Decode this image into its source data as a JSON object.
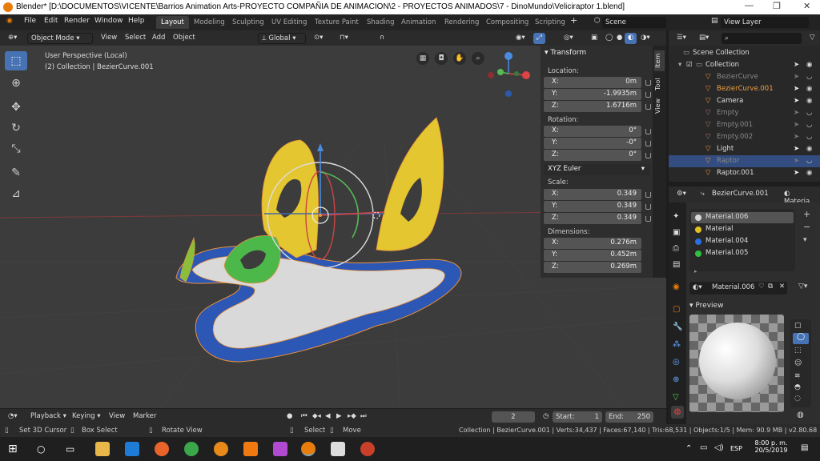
{
  "titlebar": {
    "title": "Blender* [D:\\DOCUMENTOS\\VICENTE\\Barrios Animation Arts-PROYECTO COMPAÑIA DE ANIMACION\\2 - PROYECTOS ANIMADOS\\7 - DinoMundo\\Veliciraptor 1.blend]"
  },
  "menu": [
    "File",
    "Edit",
    "Render",
    "Window",
    "Help"
  ],
  "workspaces": [
    "Layout",
    "Modeling",
    "Sculpting",
    "UV Editing",
    "Texture Paint",
    "Shading",
    "Animation",
    "Rendering",
    "Compositing",
    "Scripting"
  ],
  "scene": "Scene",
  "view_layer": "View Layer",
  "viewport_header": {
    "mode": "Object Mode",
    "menus": [
      "View",
      "Select",
      "Add",
      "Object"
    ],
    "orientation": "Global"
  },
  "viewport": {
    "perspective": "User Perspective (Local)",
    "collection": "(2) Collection | BezierCurve.001"
  },
  "npanel": {
    "header": "Transform",
    "location_label": "Location:",
    "location": [
      {
        "k": "X:",
        "v": "0m"
      },
      {
        "k": "Y:",
        "v": "-1.9935m"
      },
      {
        "k": "Z:",
        "v": "1.6716m"
      }
    ],
    "rotation_label": "Rotation:",
    "rotation": [
      {
        "k": "X:",
        "v": "0°"
      },
      {
        "k": "Y:",
        "v": "-0°"
      },
      {
        "k": "Z:",
        "v": "0°"
      }
    ],
    "rotation_mode": "XYZ Euler",
    "scale_label": "Scale:",
    "scale": [
      {
        "k": "X:",
        "v": "0.349"
      },
      {
        "k": "Y:",
        "v": "0.349"
      },
      {
        "k": "Z:",
        "v": "0.349"
      }
    ],
    "dimensions_label": "Dimensions:",
    "dimensions": [
      {
        "k": "X:",
        "v": "0.276m"
      },
      {
        "k": "Y:",
        "v": "0.452m"
      },
      {
        "k": "Z:",
        "v": "0.269m"
      }
    ]
  },
  "side_tabs": [
    "Item",
    "Tool",
    "View"
  ],
  "outliner": {
    "root": "Scene Collection",
    "collection": "Collection",
    "items": [
      {
        "label": "BezierCurve",
        "color": "#e8903a",
        "dim": true
      },
      {
        "label": "BezierCurve.001",
        "color": "#e8903a",
        "active": true
      },
      {
        "label": "Camera",
        "color": "#e8903a"
      },
      {
        "label": "Empty",
        "color": "#aa7766",
        "dim": true
      },
      {
        "label": "Empty.001",
        "color": "#aa7766",
        "dim": true
      },
      {
        "label": "Empty.002",
        "color": "#aa7766",
        "dim": true
      },
      {
        "label": "Light",
        "color": "#e8903a"
      },
      {
        "label": "Raptor",
        "color": "#e8903a",
        "dim": true,
        "selected": true
      },
      {
        "label": "Raptor.001",
        "color": "#e8903a"
      }
    ]
  },
  "properties": {
    "object": "BezierCurve.001",
    "tab": "Materia",
    "materials": [
      {
        "name": "Material.006",
        "color": "#d8d8d8"
      },
      {
        "name": "Material",
        "color": "#e0c020"
      },
      {
        "name": "Material.004",
        "color": "#2a6ee0"
      },
      {
        "name": "Material.005",
        "color": "#30c040"
      }
    ],
    "active_material": "Material.006",
    "preview_label": "Preview"
  },
  "timeline": {
    "menus": [
      "Playback",
      "Keying",
      "View",
      "Marker"
    ],
    "frame": "2",
    "start_label": "Start:",
    "start": "1",
    "end_label": "End:",
    "end": "250"
  },
  "statusbar": {
    "left": [
      "Set 3D Cursor",
      "Box Select",
      "Rotate View"
    ],
    "mid": [
      "Select",
      "Move"
    ],
    "stats": "Collection | BezierCurve.001 | Verts:34,437 | Faces:67,140 | Tris:68,531 | Objects:1/5 | Mem: 90.9 MB | v2.80.68"
  },
  "taskbar": {
    "time": "8:00 p. m.",
    "date": "20/5/2019",
    "lang": "ESP"
  }
}
